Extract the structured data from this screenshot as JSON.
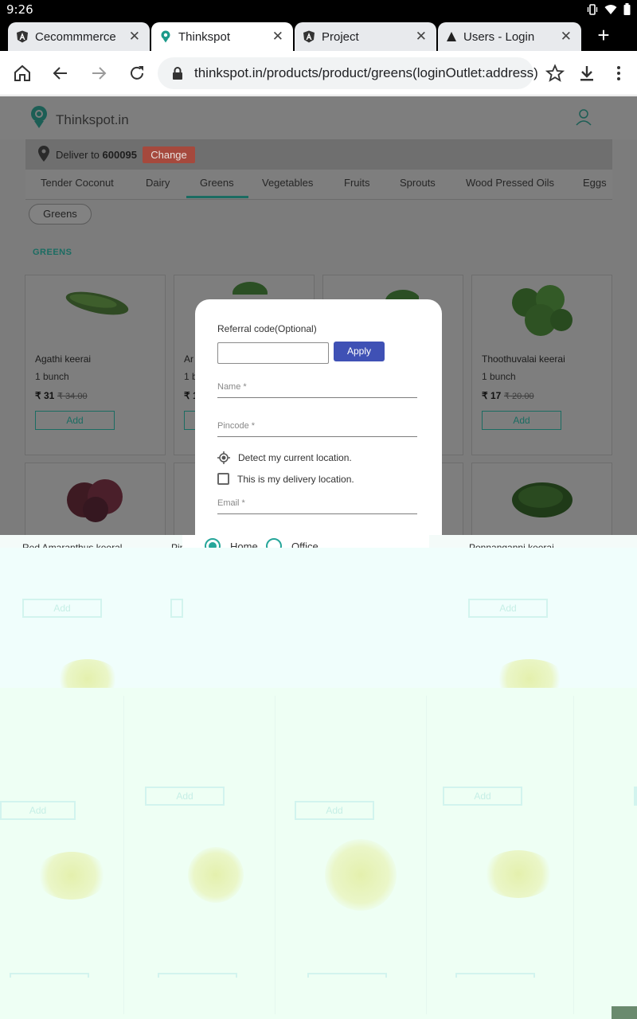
{
  "status_bar": {
    "time": "9:26"
  },
  "tabs": [
    {
      "title": "Cecommmerce",
      "icon": "angular-icon",
      "active": false
    },
    {
      "title": "Thinkspot",
      "icon": "thinkspot-icon",
      "active": true
    },
    {
      "title": "Project",
      "icon": "angular-icon",
      "active": false
    },
    {
      "title": "Users - Login",
      "icon": "triangle-icon",
      "active": false
    }
  ],
  "toolbar": {
    "url": "thinkspot.in/products/product/greens(loginOutlet:address)"
  },
  "site": {
    "logo_text": "Thinkspot.in",
    "deliver_label": "Deliver to",
    "pincode": "600095",
    "change_label": "Change",
    "categories": [
      "Tender Coconut",
      "Dairy",
      "Greens",
      "Vegetables",
      "Fruits",
      "Sprouts",
      "Wood Pressed Oils",
      "Eggs"
    ],
    "active_category": "Greens",
    "chip": "Greens",
    "section_title": "GREENS"
  },
  "products": [
    {
      "name": "Agathi keerai",
      "qty": "1 bunch",
      "price": "₹ 31",
      "mrp": "₹ 34.00",
      "add": "Add"
    },
    {
      "name": "Ar",
      "qty": "1 b",
      "price": "₹ 1",
      "mrp": "",
      "add": "Add"
    },
    {
      "name": "",
      "qty": "",
      "price": "",
      "mrp": "",
      "add": ""
    },
    {
      "name": "Thoothuvalai keerai",
      "qty": "1 bunch",
      "price": "₹ 17",
      "mrp": "₹ 20.00",
      "add": "Add"
    }
  ],
  "second_row_names": [
    "Red Amaranthus keeral",
    "Pin",
    "Ponnanganni keerai"
  ],
  "modal": {
    "referral_label": "Referral code(Optional)",
    "apply_label": "Apply",
    "name_placeholder": "Name *",
    "pincode_placeholder": "Pincode *",
    "detect_label": "Detect my current location.",
    "delivery_check_label": "This is my delivery location.",
    "email_placeholder": "Email *",
    "address_type_options": [
      "Home",
      "Office"
    ],
    "address_type_selected": "Home"
  },
  "ghost_add_label": "Add",
  "colors": {
    "brand_green": "#1b6c62",
    "apply_blue": "#3f51b5",
    "change_red": "#e35a4a",
    "radio_teal": "#26a69a"
  }
}
